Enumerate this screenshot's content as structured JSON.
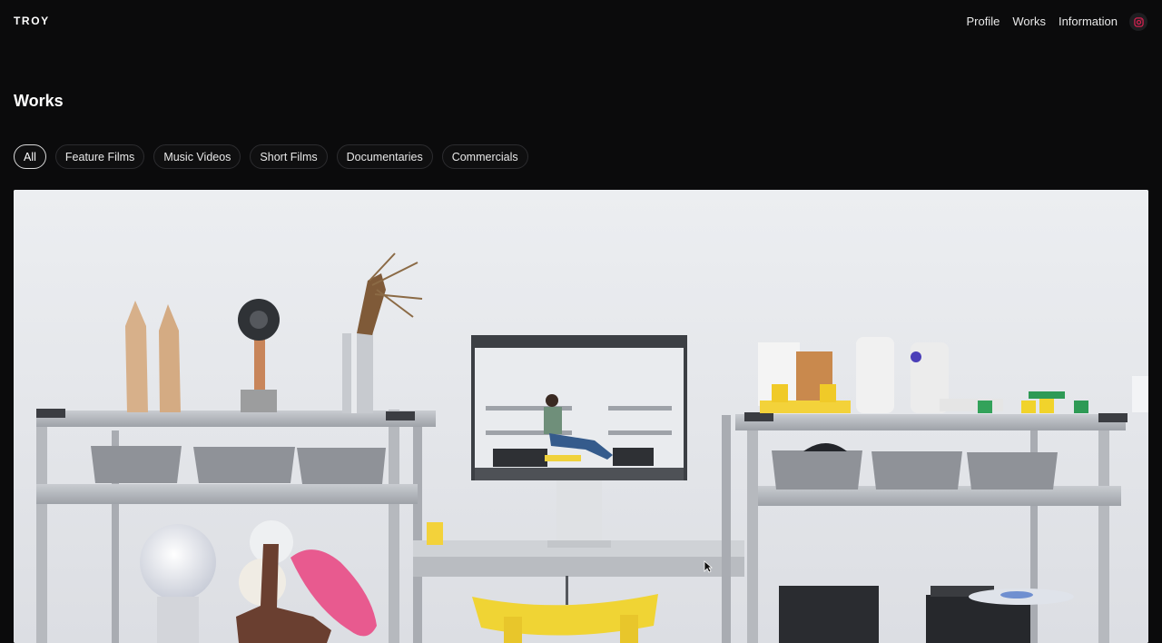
{
  "header": {
    "brand": "TROY",
    "nav": [
      {
        "label": "Profile"
      },
      {
        "label": "Works"
      },
      {
        "label": "Information"
      }
    ],
    "social_icon": "instagram-icon",
    "social_icon_color": "#d2214f"
  },
  "page": {
    "title": "Works"
  },
  "filters": [
    {
      "label": "All",
      "active": true
    },
    {
      "label": "Feature Films",
      "active": false
    },
    {
      "label": "Music Videos",
      "active": false
    },
    {
      "label": "Short Films",
      "active": false
    },
    {
      "label": "Documentaries",
      "active": false
    },
    {
      "label": "Commercials",
      "active": false
    }
  ],
  "hero": {
    "icon": "video-still-image",
    "background_color": "#e4e6ea"
  }
}
